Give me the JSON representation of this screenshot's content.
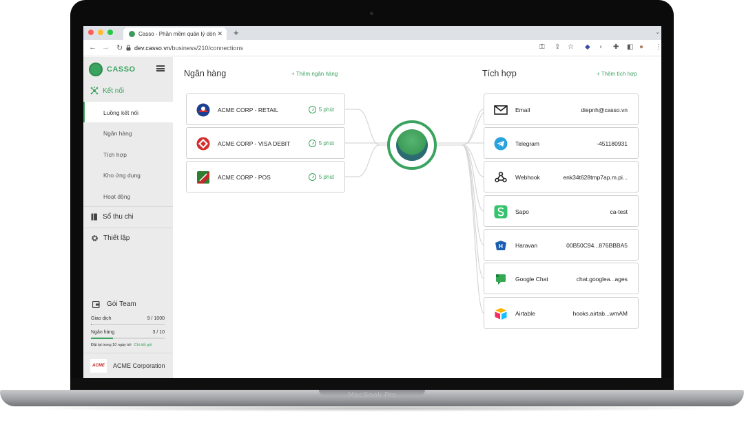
{
  "device": {
    "label": "MacBook Pro"
  },
  "browser": {
    "tab_title": "Casso - Phần mềm quản lý dòn",
    "url_host": "dev.casso.vn",
    "url_path": "/business/210/connections"
  },
  "sidebar": {
    "brand": "CASSO",
    "connect_label": "Kết nối",
    "sub_items": [
      "Luồng kết nối",
      "Ngân hàng",
      "Tích hợp",
      "Kho ứng dụng",
      "Hoạt động"
    ],
    "ledger_label": "Sổ thu chi",
    "settings_label": "Thiết lập",
    "plan": {
      "title": "Gói Team",
      "transactions_label": "Giao dịch",
      "transactions_value": "9 / 1000",
      "transactions_fraction": 0.009,
      "banks_label": "Ngân hàng",
      "banks_value": "3 / 10",
      "banks_fraction": 0.3,
      "renew_text": "Đặt lại trong 10 ngày tới",
      "detail_link": "Chi tiết gói"
    },
    "company": {
      "logo_text": "ACME",
      "name": "ACME Corporation"
    }
  },
  "banks": {
    "title": "Ngân hàng",
    "add_label": "+ Thêm ngân hàng",
    "items": [
      {
        "name": "ACME CORP - RETAIL",
        "status": "5 phút"
      },
      {
        "name": "ACME CORP - VISA DEBIT",
        "status": "5 phút"
      },
      {
        "name": "ACME CORP - POS",
        "status": "5 phút"
      }
    ]
  },
  "integrations": {
    "title": "Tích hợp",
    "add_label": "+ Thêm tích hợp",
    "items": [
      {
        "name": "Email",
        "value": "diepnh@casso.vn",
        "icon": "mail-icon"
      },
      {
        "name": "Telegram",
        "value": "-451180931",
        "icon": "telegram-icon"
      },
      {
        "name": "Webhook",
        "value": "enk34t628tmp7ap.m.pi...",
        "icon": "webhook-icon"
      },
      {
        "name": "Sapo",
        "value": "ca-test",
        "icon": "sapo-icon"
      },
      {
        "name": "Haravan",
        "value": "00B50C94...876BBBA5",
        "icon": "haravan-icon"
      },
      {
        "name": "Google Chat",
        "value": "chat.googlea...ages",
        "icon": "google-chat-icon"
      },
      {
        "name": "Airtable",
        "value": "hooks.airtab...wmAM",
        "icon": "airtable-icon"
      }
    ]
  },
  "colors": {
    "accent": "#3aa35f",
    "sidebar_bg": "#ebebeb",
    "border": "#d0d0d0"
  }
}
